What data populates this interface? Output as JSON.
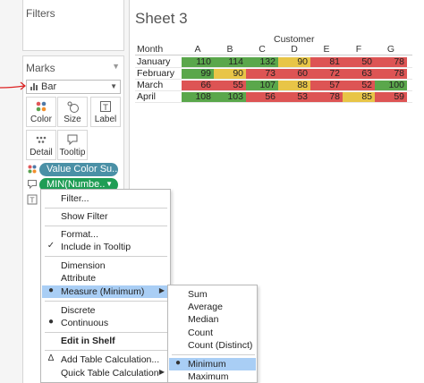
{
  "filters": {
    "title": "Filters"
  },
  "marks": {
    "title": "Marks",
    "mark_type": "Bar",
    "buttons": [
      {
        "label": "Color",
        "icon": "color-dots-icon"
      },
      {
        "label": "Size",
        "icon": "size-icon"
      },
      {
        "label": "Label",
        "icon": "label-icon"
      },
      {
        "label": "Detail",
        "icon": "detail-icon"
      },
      {
        "label": "Tooltip",
        "icon": "tooltip-icon"
      }
    ],
    "pills": [
      {
        "label": "Value Color Su..",
        "color": "#4a90a6",
        "icon": "color-dots-icon"
      },
      {
        "label": "MIN(Numbe..",
        "color": "#1f9d55",
        "icon": "tooltip-icon"
      }
    ]
  },
  "sheet": {
    "title": "Sheet 3",
    "column_group": "Customer",
    "row_header": "Month",
    "columns": [
      "A",
      "B",
      "C",
      "D",
      "E",
      "F",
      "G"
    ],
    "rows": [
      {
        "month": "January",
        "values": [
          "110",
          "114",
          "132",
          "90",
          "81",
          "50",
          "78"
        ]
      },
      {
        "month": "February",
        "values": [
          "99",
          "90",
          "73",
          "60",
          "72",
          "63",
          "78"
        ]
      },
      {
        "month": "March",
        "values": [
          "66",
          "55",
          "107",
          "88",
          "57",
          "52",
          "100"
        ]
      },
      {
        "month": "April",
        "values": [
          "108",
          "103",
          "56",
          "53",
          "78",
          "85",
          "59"
        ]
      }
    ],
    "colors": {
      "green": "#5aa74b",
      "yellow": "#e8c547",
      "red": "#dd5454"
    }
  },
  "context_menu": {
    "items": [
      {
        "label": "Filter...",
        "check": ""
      },
      {
        "label": "Show Filter",
        "check": ""
      },
      {
        "label": "Format...",
        "check": ""
      },
      {
        "label": "Include in Tooltip",
        "check": "✓"
      },
      {
        "label": "Dimension",
        "check": ""
      },
      {
        "label": "Attribute",
        "check": ""
      },
      {
        "label": "Measure (Minimum)",
        "check": "●"
      },
      {
        "label": "Discrete",
        "check": ""
      },
      {
        "label": "Continuous",
        "check": "●"
      },
      {
        "label": "Edit in Shelf",
        "check": ""
      },
      {
        "label": "Add Table Calculation...",
        "check": ""
      },
      {
        "label": "Quick Table Calculation",
        "check": ""
      }
    ]
  },
  "submenu": {
    "items": [
      {
        "label": "Sum",
        "check": ""
      },
      {
        "label": "Average",
        "check": ""
      },
      {
        "label": "Median",
        "check": ""
      },
      {
        "label": "Count",
        "check": ""
      },
      {
        "label": "Count (Distinct)",
        "check": ""
      },
      {
        "label": "Minimum",
        "check": "●"
      },
      {
        "label": "Maximum",
        "check": ""
      }
    ]
  }
}
